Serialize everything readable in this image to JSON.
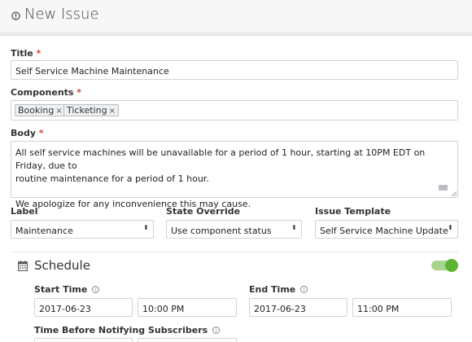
{
  "header": {
    "title": "New Issue",
    "icon": "info-circle-icon"
  },
  "form": {
    "title": {
      "label": "Title",
      "required": "*",
      "value": "Self Service Machine Maintenance"
    },
    "components": {
      "label": "Components",
      "required": "*",
      "chips": [
        {
          "label": "Booking",
          "remove": "×"
        },
        {
          "label": "Ticketing",
          "remove": "×"
        }
      ]
    },
    "body": {
      "label": "Body",
      "required": "*",
      "lines": [
        "All self service machines will be unavailable for a period of 1 hour, starting at 10PM EDT on Friday, due to",
        "routine maintenance for a period of 1 hour.",
        "We apologize for any inconvenience this may cause."
      ]
    },
    "label_field": {
      "label": "Label",
      "value": "Maintenance",
      "caret": "⬍"
    },
    "state_override": {
      "label": "State Override",
      "value": "Use component status",
      "caret": "⬍"
    },
    "issue_template": {
      "label": "Issue Template",
      "value": "Self Service Machine Update",
      "caret": "⬍"
    }
  },
  "schedule": {
    "title": "Schedule",
    "toggle_on": true,
    "start_time": {
      "label": "Start Time",
      "info": "i",
      "date": "2017-06-23",
      "time": "10:00 PM"
    },
    "end_time": {
      "label": "End Time",
      "info": "i",
      "date": "2017-06-23",
      "time": "11:00 PM"
    },
    "notify": {
      "label": "Time Before Notifying Subscribers",
      "info": "i"
    }
  },
  "colors": {
    "accent": "#5cb532",
    "toggle_track": "#a9d48f",
    "required": "#d0463b"
  }
}
